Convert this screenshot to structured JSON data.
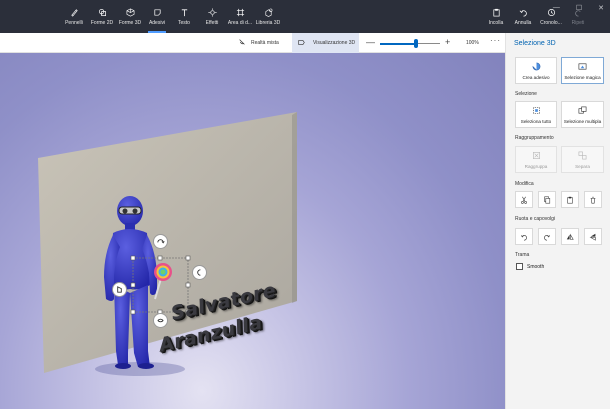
{
  "toolbar": {
    "tools": [
      {
        "label": "Pennelli",
        "icon": "brush-icon"
      },
      {
        "label": "Forme 2D",
        "icon": "shapes-2d-icon"
      },
      {
        "label": "Forme 3D",
        "icon": "cube-3d-icon"
      },
      {
        "label": "Adesivi",
        "icon": "sticker-icon"
      },
      {
        "label": "Testo",
        "icon": "text-icon"
      },
      {
        "label": "Effetti",
        "icon": "effects-icon"
      },
      {
        "label": "Area di d...",
        "icon": "canvas-icon"
      },
      {
        "label": "Libreria 3D",
        "icon": "library-3d-icon"
      }
    ],
    "right_tools": [
      {
        "label": "Incolla",
        "icon": "paste-icon"
      },
      {
        "label": "Annulla",
        "icon": "undo-icon"
      },
      {
        "label": "Cronolo...",
        "icon": "history-icon"
      },
      {
        "label": "Ripeti",
        "icon": "redo-icon"
      }
    ],
    "window_controls": {
      "minimize": "—",
      "maximize": "☐",
      "close": "✕"
    }
  },
  "view_bar": {
    "mixed_reality": "Realtà mista",
    "view_3d": "Visualizzazione 3D",
    "zoom_minus": "—",
    "zoom_plus": "+",
    "zoom_value": "100%",
    "zoom_level": 0.6,
    "more": "···"
  },
  "canvas": {
    "sticker_line1": "Salvatore",
    "sticker_line2": "Aranzulla"
  },
  "panel": {
    "title": "Selezione 3D",
    "top_actions": [
      {
        "label": "Crea adesivo",
        "icon": "make-sticker-icon"
      },
      {
        "label": "Selezione magica",
        "icon": "magic-select-icon"
      }
    ],
    "selection_label": "Selezione",
    "selection_actions": [
      {
        "label": "Seleziona tutto",
        "icon": "select-all-icon"
      },
      {
        "label": "Selezione multipla",
        "icon": "multi-select-icon"
      }
    ],
    "group_label": "Raggruppamento",
    "group_actions": [
      {
        "label": "Raggruppa",
        "icon": "group-icon"
      },
      {
        "label": "Separa",
        "icon": "ungroup-icon"
      }
    ],
    "edit_label": "Modifica",
    "rotate_label": "Ruota e capovolgi",
    "texture_label": "Trama",
    "smooth_label": "Smooth",
    "colors": {
      "accent": "#0067c0",
      "toolbar_bg": "#2b2f3a"
    }
  }
}
